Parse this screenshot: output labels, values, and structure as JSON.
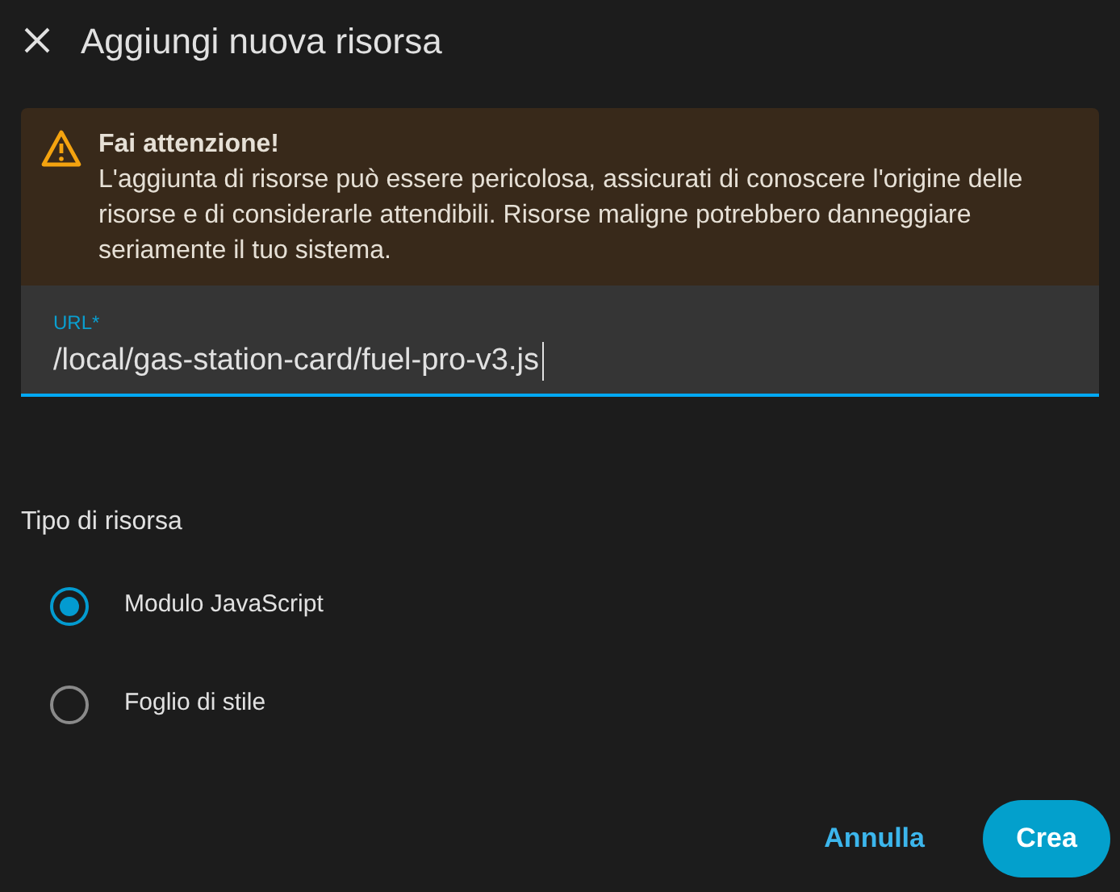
{
  "dialog": {
    "title": "Aggiungi nuova risorsa"
  },
  "warning": {
    "title": "Fai attenzione!",
    "message": "L'aggiunta di risorse può essere pericolosa, assicurati di conoscere l'origine delle risorse e di considerarle attendibili. Risorse maligne potrebbero danneggiare seriamente il tuo sistema."
  },
  "url_field": {
    "label": "URL*",
    "value": "/local/gas-station-card/fuel-pro-v3.js",
    "focused": true
  },
  "resource_type": {
    "label": "Tipo di risorsa",
    "options": [
      {
        "label": "Modulo JavaScript",
        "selected": true
      },
      {
        "label": "Foglio di stile",
        "selected": false
      }
    ]
  },
  "buttons": [
    {
      "label": "Annulla",
      "kind": "text"
    },
    {
      "label": "Crea",
      "kind": "filled"
    }
  ]
}
